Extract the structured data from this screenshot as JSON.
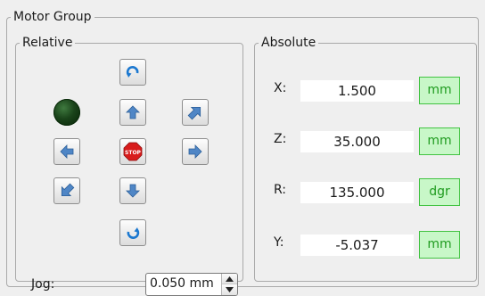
{
  "motor_group": {
    "title": "Motor Group"
  },
  "relative": {
    "title": "Relative",
    "jog_label": "Jog:",
    "jog_value": "0.050 mm",
    "stop_label": "STOP"
  },
  "absolute": {
    "title": "Absolute",
    "axes": [
      {
        "label": "X:",
        "value": "1.500",
        "unit": "mm"
      },
      {
        "label": "Z:",
        "value": "35.000",
        "unit": "mm"
      },
      {
        "label": "R:",
        "value": "135.000",
        "unit": "dgr"
      },
      {
        "label": "Y:",
        "value": "-5.037",
        "unit": "mm"
      }
    ]
  },
  "colors": {
    "arrow_blue": "#4f86c6",
    "rotate_blue": "#1b78d0",
    "stop_red": "#d81c1c",
    "unit_green": "#c8f7c8",
    "led_green": "#1a431a"
  },
  "icons": [
    "rotate-cw-icon",
    "arrow-up-icon",
    "arrow-down-icon",
    "arrow-left-icon",
    "arrow-right-icon",
    "arrow-up-right-icon",
    "arrow-down-left-icon",
    "stop-icon",
    "rotate-ccw-icon",
    "status-led"
  ]
}
